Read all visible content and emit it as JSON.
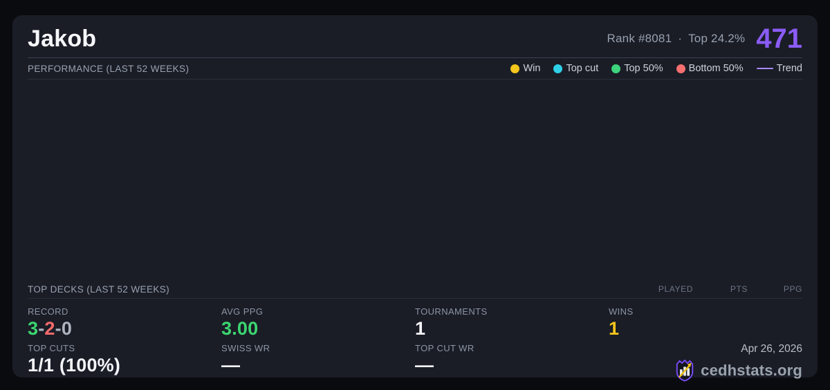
{
  "header": {
    "player_name": "Jakob",
    "rank_text": "Rank #8081",
    "separator": "·",
    "top_percent": "Top 24.2%",
    "score": "471"
  },
  "performance": {
    "title": "PERFORMANCE (LAST 52 WEEKS)",
    "legend": [
      {
        "label": "Win",
        "type": "dot",
        "color": "#f4c51b"
      },
      {
        "label": "Top cut",
        "type": "dot",
        "color": "#2fd0e8"
      },
      {
        "label": "Top 50%",
        "type": "dot",
        "color": "#3dd47d"
      },
      {
        "label": "Bottom 50%",
        "type": "dot",
        "color": "#f76f6f"
      },
      {
        "label": "Trend",
        "type": "line",
        "color": "#a78bfa"
      }
    ],
    "chart_points": []
  },
  "top_decks": {
    "title": "TOP DECKS (LAST 52 WEEKS)",
    "columns": [
      "PLAYED",
      "PTS",
      "PPG"
    ],
    "rows": []
  },
  "stats": {
    "record": {
      "label": "RECORD",
      "wins": "3",
      "losses": "2",
      "draws": "0",
      "separator": "-"
    },
    "avg_ppg": {
      "label": "AVG PPG",
      "value": "3.00"
    },
    "tournaments": {
      "label": "TOURNAMENTS",
      "value": "1"
    },
    "wins": {
      "label": "WINS",
      "value": "1"
    },
    "top_cuts": {
      "label": "TOP CUTS",
      "value": "1/1 (100%)"
    },
    "swiss_wr": {
      "label": "SWISS WR",
      "value": "—"
    },
    "top_cut_wr": {
      "label": "TOP CUT WR",
      "value": "—"
    }
  },
  "footer": {
    "date": "Apr 26, 2026",
    "brand": "cedhstats.org"
  },
  "colors": {
    "accent_purple": "#8b5cf6",
    "green": "#3bd671",
    "red": "#f56b6b",
    "draw_gray": "#aeb4c0",
    "yellow": "#f4c51b",
    "trend_purple": "#a78bfa",
    "logo_purple": "#7c4dff",
    "logo_gold": "#f4c51b"
  }
}
